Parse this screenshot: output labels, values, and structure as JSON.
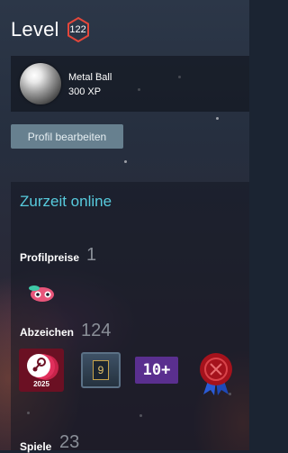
{
  "header": {
    "level_label": "Level",
    "level_value": "122"
  },
  "showcase": {
    "item_name": "Metal Ball",
    "item_xp": "300 XP"
  },
  "actions": {
    "edit_profile": "Profil bearbeiten"
  },
  "panel": {
    "status": "Zurzeit online",
    "awards_label": "Profilpreise",
    "awards_count": "1",
    "badges_label": "Abzeichen",
    "badges_count": "124",
    "badges": [
      {
        "icon": "steam-2025-badge",
        "text": "2025"
      },
      {
        "icon": "level-9-badge",
        "text": "9"
      },
      {
        "icon": "10-plus-badge",
        "text": "10+"
      },
      {
        "icon": "wax-seal-badge"
      }
    ],
    "games_label": "Spiele",
    "games_count": "23"
  },
  "colors": {
    "accent": "#57cbde",
    "button_bg": "#67808f",
    "level_ring": "#e4473b"
  }
}
